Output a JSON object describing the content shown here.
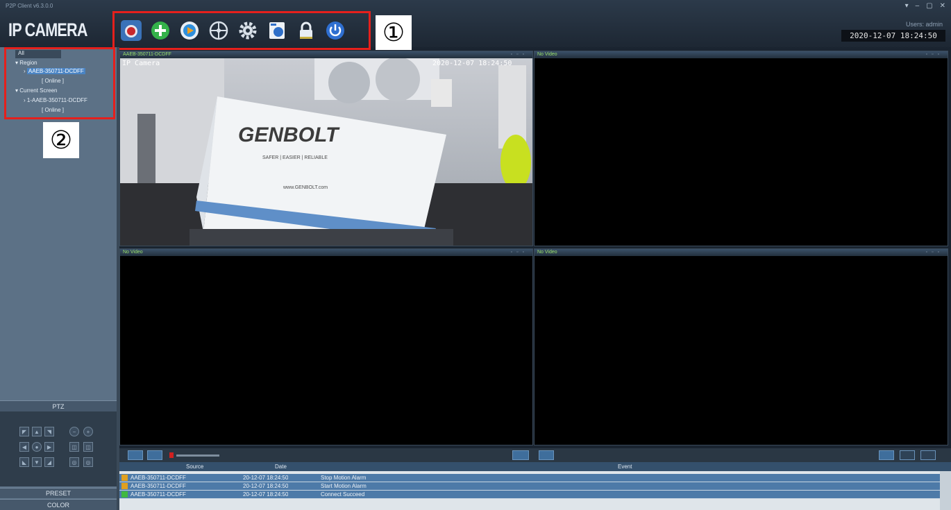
{
  "window": {
    "title": "P2P Client v6.3.0.0",
    "controls": [
      "▾",
      "–",
      "▢",
      "✕"
    ]
  },
  "brand": {
    "logo_text": "IP CAMERA"
  },
  "toolbar": {
    "items": [
      {
        "name": "monitor",
        "icon": "camera-record-icon"
      },
      {
        "name": "add-device",
        "icon": "plus-circle-icon"
      },
      {
        "name": "playback",
        "icon": "play-circle-icon"
      },
      {
        "name": "ptz-view",
        "icon": "crosshair-icon"
      },
      {
        "name": "settings",
        "icon": "gear-icon"
      },
      {
        "name": "emap",
        "icon": "map-icon"
      },
      {
        "name": "lock",
        "icon": "lock-icon"
      },
      {
        "name": "exit",
        "icon": "power-icon"
      }
    ],
    "annotation_label": "①"
  },
  "header_right": {
    "user_text": "Users: admin",
    "datetime": "2020-12-07 18:24:50"
  },
  "sidebar": {
    "tab_label": "All",
    "annotation_label": "②",
    "tree": [
      {
        "label": "Region",
        "level": 0
      },
      {
        "label": "AAEB-350711-DCDFF",
        "level": 1,
        "selected": true
      },
      {
        "label": "[ Online ]",
        "level": 2
      },
      {
        "label": "Current Screen",
        "level": 0
      },
      {
        "label": "1-AAEB-350711-DCDFF",
        "level": 1
      },
      {
        "label": "[ Online ]",
        "level": 2
      }
    ]
  },
  "ptz": {
    "label": "PTZ"
  },
  "preset": {
    "label": "PRESET"
  },
  "color_section": {
    "label": "COLOR"
  },
  "video": {
    "panes": [
      {
        "title": "AAEB-350711-DCDFF",
        "osd_name": "IP Camera",
        "osd_time": "2020-12-07 18:24:50",
        "brand_text": "GENBOLT",
        "brand_tagline": "SAFER | EASIER | RELIABLE",
        "brand_url": "www.GENBOLT.com"
      },
      {
        "title": "No Video"
      },
      {
        "title": "No Video"
      },
      {
        "title": "No Video"
      }
    ]
  },
  "events": {
    "columns": [
      "Source",
      "Date",
      "Event"
    ],
    "rows": [
      {
        "source": "AAEB-350711-DCDFF",
        "date": "20-12-07 18:24:50",
        "event": "Stop Motion Alarm",
        "status": "warn"
      },
      {
        "source": "AAEB-350711-DCDFF",
        "date": "20-12-07 18:24:50",
        "event": "Start Motion Alarm",
        "status": "warn"
      },
      {
        "source": "AAEB-350711-DCDFF",
        "date": "20-12-07 18:24:50",
        "event": "Connect Succeed",
        "status": "ok"
      }
    ]
  },
  "colors": {
    "annotation_red": "#e5201c",
    "accent_blue": "#4a84c4"
  }
}
